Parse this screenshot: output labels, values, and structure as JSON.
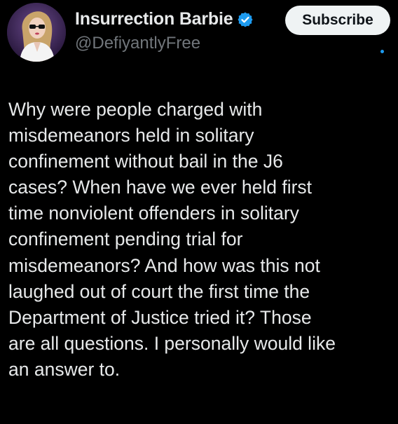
{
  "author": {
    "display_name": "Insurrection Barbie",
    "handle": "@DefiyantlyFree",
    "verified": true,
    "avatar_icon": "avatar-woman-sunglasses-icon"
  },
  "actions": {
    "subscribe_label": "Subscribe"
  },
  "tweet": {
    "text": "Why were people charged with\nmisdemeanors held in solitary\nconfinement without bail in the J6\ncases? When have we ever held first\ntime nonviolent offenders in solitary\nconfinement pending trial for\nmisdemeanors? And how was this not\nlaughed out of court the first time the\nDepartment of Justice tried it? Those\nare all questions. I personally would like\nan answer to."
  },
  "colors": {
    "background": "#000000",
    "text": "#e7e9ea",
    "secondary_text": "#71767b",
    "accent": "#1d9bf0",
    "button_bg": "#eff3f4"
  }
}
